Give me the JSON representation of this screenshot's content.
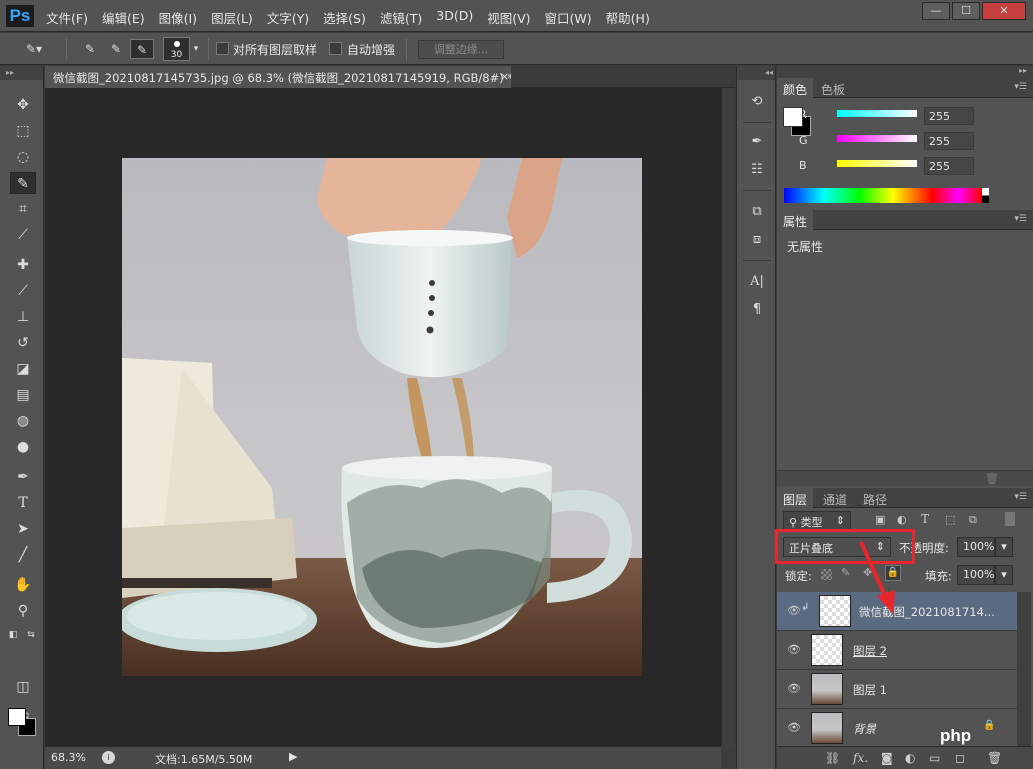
{
  "app": {
    "logo": "Ps"
  },
  "menu": [
    "文件(F)",
    "编辑(E)",
    "图像(I)",
    "图层(L)",
    "文字(Y)",
    "选择(S)",
    "滤镜(T)",
    "3D(D)",
    "视图(V)",
    "窗口(W)",
    "帮助(H)"
  ],
  "window_controls": {
    "minimize": "—",
    "restore": "☐",
    "close": "✕"
  },
  "options": {
    "brush_size": "30",
    "sample_all_layers": "对所有图层取样",
    "auto_enhance": "自动增强",
    "refine_edge": "调整边缘..."
  },
  "document": {
    "tab_title": "微信截图_20210817145735.jpg @ 68.3% (微信截图_20210817145919, RGB/8#) *",
    "close": "×",
    "zoom": "68.3%",
    "doc_info": "文档:1.65M/5.50M"
  },
  "color_panel": {
    "tabs": [
      "颜色",
      "色板"
    ],
    "channels": [
      {
        "label": "R",
        "value": "255",
        "color": "#00ffff"
      },
      {
        "label": "G",
        "value": "255",
        "color": "#ff00ff"
      },
      {
        "label": "B",
        "value": "255",
        "color": "#ffff00"
      }
    ]
  },
  "properties_panel": {
    "tab": "属性",
    "empty_text": "无属性"
  },
  "layers_panel": {
    "tabs": [
      "图层",
      "通道",
      "路径"
    ],
    "filter_kind": "类型",
    "blend_mode": "正片叠底",
    "opacity_label": "不透明度:",
    "opacity": "100%",
    "lock_label": "锁定:",
    "fill_label": "填充:",
    "fill": "100%",
    "layers": [
      {
        "name": "微信截图_2021081714...",
        "selected": true
      },
      {
        "name": "图层 2",
        "selected": false
      },
      {
        "name": "图层 1",
        "selected": false
      },
      {
        "name": "背景",
        "selected": false
      }
    ],
    "bottom_fx": "fx."
  },
  "watermark": "php",
  "accent": {
    "highlight_box": "#e8262b",
    "selected_layer": "#5a6a80",
    "ps_blue": "#31a8ff"
  }
}
